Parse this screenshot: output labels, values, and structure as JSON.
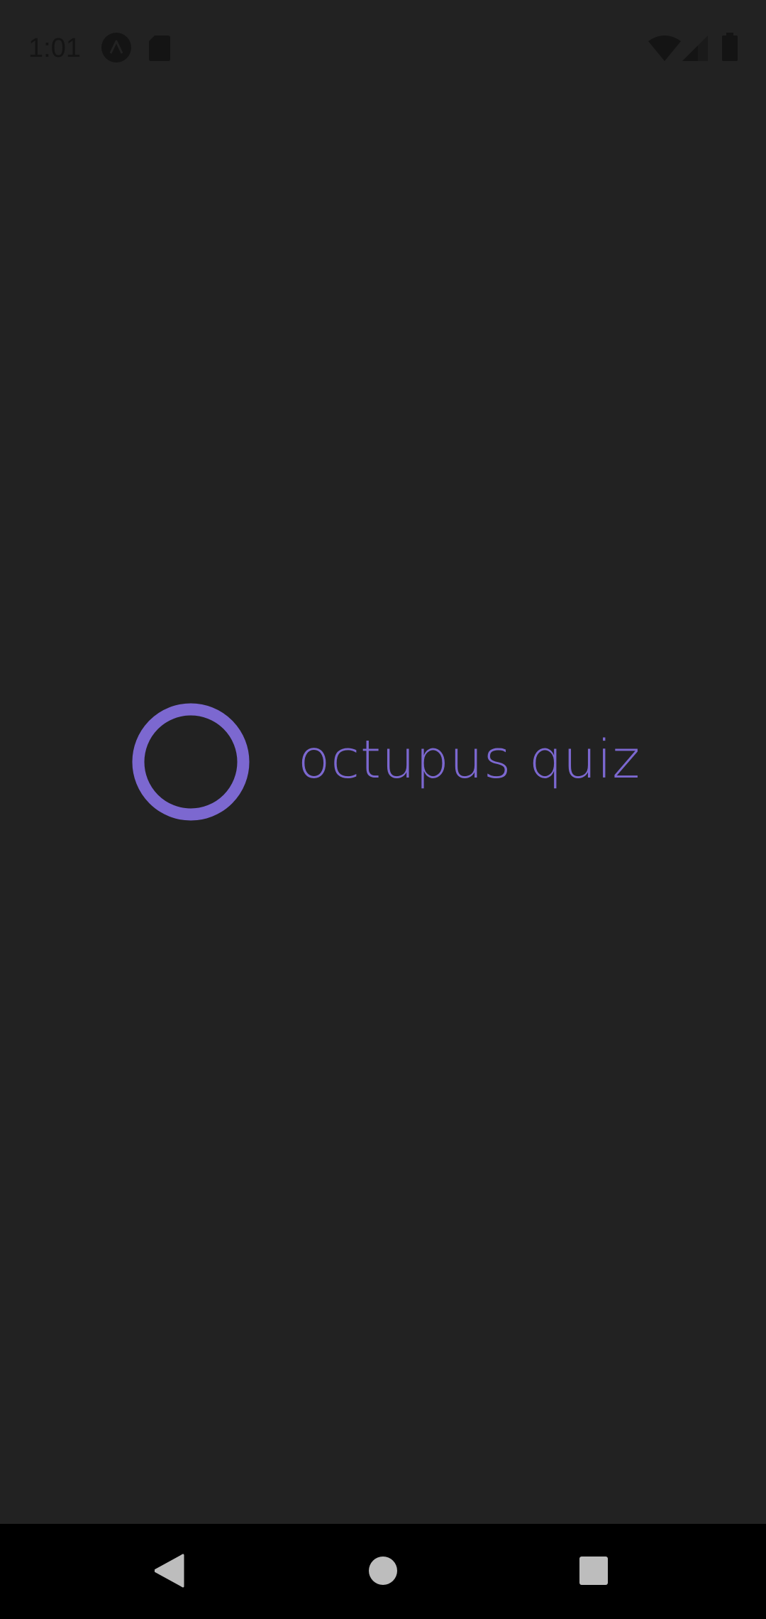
{
  "status_bar": {
    "time": "1:01",
    "icons": [
      "assistant-icon",
      "sd-card-icon",
      "wifi-icon",
      "signal-icon",
      "battery-icon"
    ]
  },
  "splash": {
    "logo_icon": "ring-logo-icon",
    "app_name": "octupus quiz",
    "accent_color": "#7c68d0",
    "background_color": "#222222"
  },
  "nav_bar": {
    "buttons": [
      "back-icon",
      "home-icon",
      "recents-icon"
    ]
  }
}
